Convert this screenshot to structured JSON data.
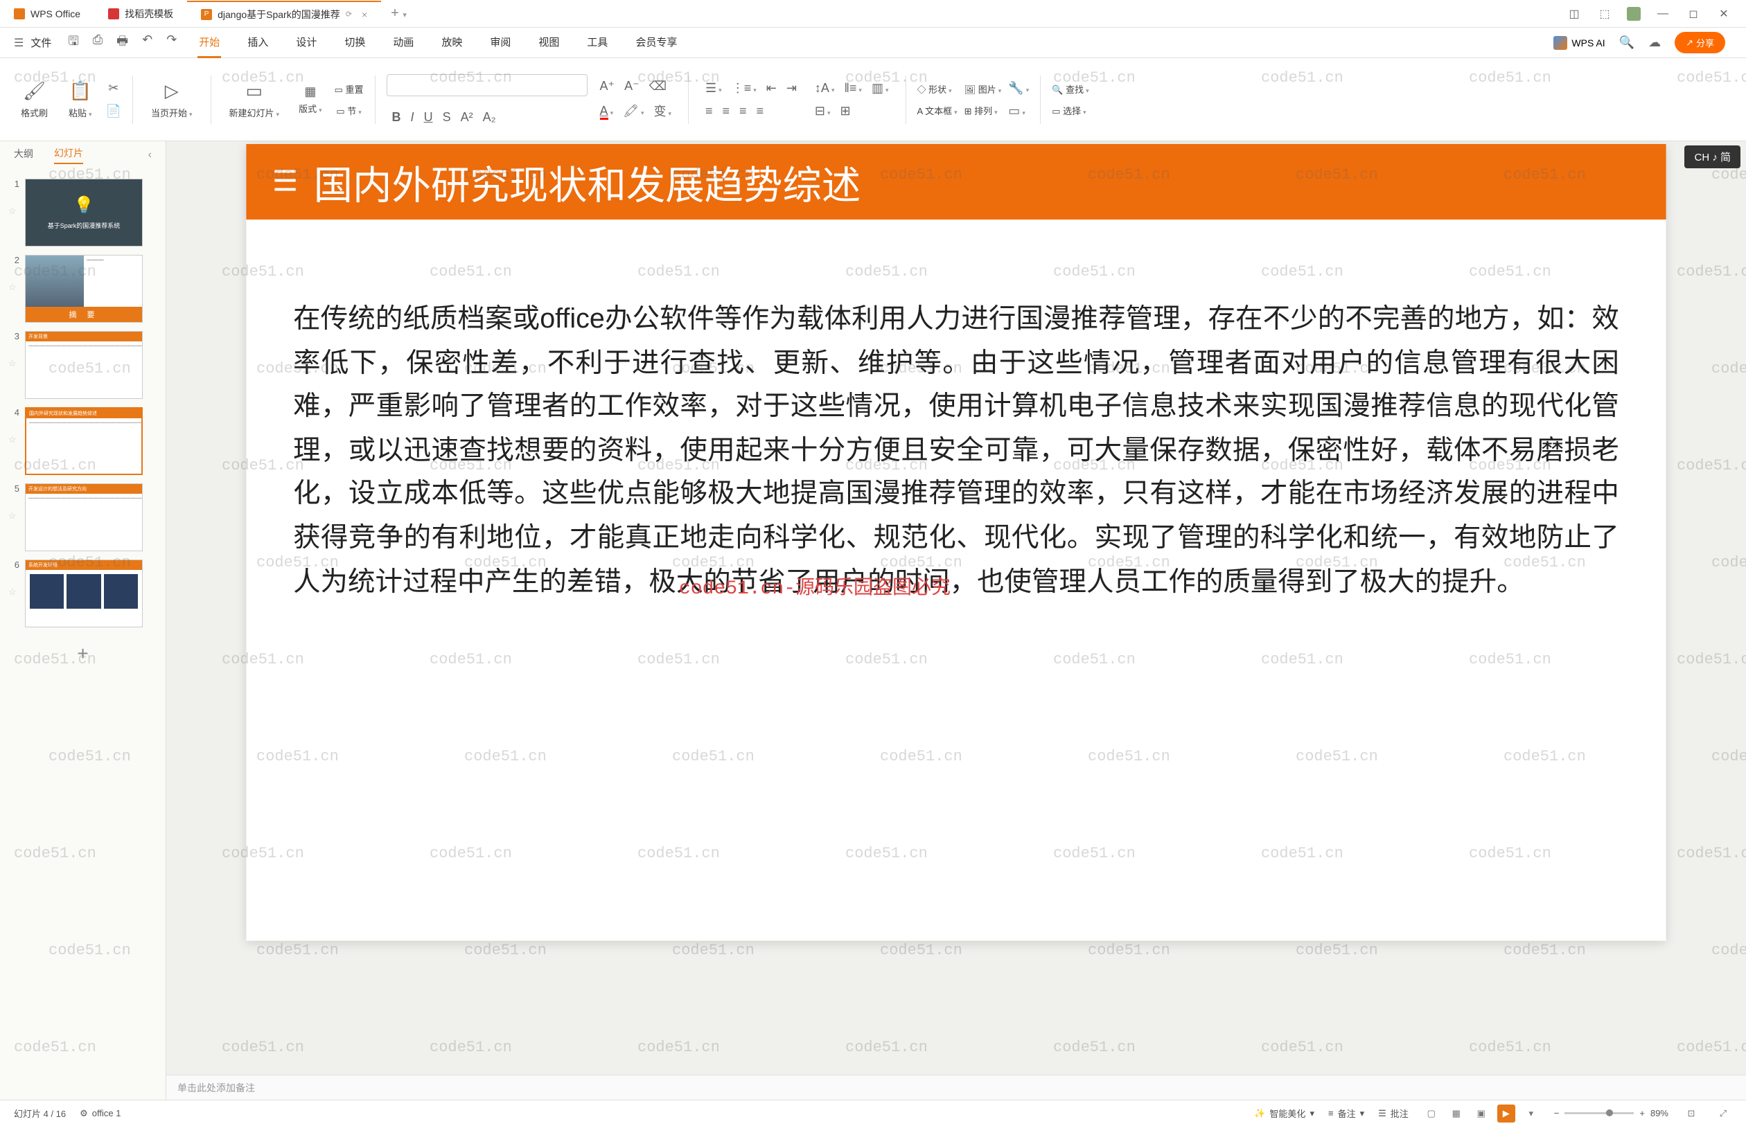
{
  "titlebar": {
    "tabs": [
      {
        "label": "WPS Office"
      },
      {
        "label": "找稻壳模板"
      },
      {
        "label": "django基于Spark的国漫推荐"
      }
    ],
    "add": "+"
  },
  "menubar": {
    "file": "文件",
    "tabs": [
      "开始",
      "插入",
      "设计",
      "切换",
      "动画",
      "放映",
      "审阅",
      "视图",
      "工具",
      "会员专享"
    ],
    "ai": "WPS AI",
    "share": "分享"
  },
  "ribbon": {
    "formatbrush": "格式刷",
    "paste": "粘贴",
    "currentstart": "当页开始",
    "newslide": "新建幻灯片",
    "layout": "版式",
    "section": "节",
    "reset": "重置",
    "shape": "形状",
    "image": "图片",
    "textbox": "文本框",
    "arrange": "排列",
    "find": "查找",
    "select": "选择"
  },
  "leftpanel": {
    "outline": "大纲",
    "slides": "幻灯片"
  },
  "thumbs": {
    "t1": "基于Spark的国漫推荐系统",
    "t2": "摘    要",
    "t3": "开发背景",
    "t4": "国内外研究现状和发展趋势综述",
    "t5": "开发设计的想法及研究方向",
    "t6": "系统开发环境"
  },
  "slide": {
    "title": "国内外研究现状和发展趋势综述",
    "body": "在传统的纸质档案或office办公软件等作为载体利用人力进行国漫推荐管理，存在不少的不完善的地方，如：效率低下，保密性差，不利于进行查找、更新、维护等。由于这些情况，管理者面对用户的信息管理有很大困难，严重影响了管理者的工作效率，对于这些情况，使用计算机电子信息技术来实现国漫推荐信息的现代化管理，或以迅速查找想要的资料，使用起来十分方便且安全可靠，可大量保存数据，保密性好，载体不易磨损老化，设立成本低等。这些优点能够极大地提高国漫推荐管理的效率，只有这样，才能在市场经济发展的进程中获得竞争的有利地位，才能真正地走向科学化、规范化、现代化。实现了管理的科学化和统一，有效地防止了人为统计过程中产生的差错，极大的节省了用户的时间，也使管理人员工作的质量得到了极大的提升。"
  },
  "badge": {
    "text": "CH ♪ 简"
  },
  "notes": {
    "placeholder": "单击此处添加备注"
  },
  "status": {
    "slide": "幻灯片 4 / 16",
    "office": "office 1",
    "beautify": "智能美化",
    "notes": "备注",
    "approve": "批注",
    "zoom": "89%"
  },
  "watermark": {
    "text": "code51.cn",
    "red": "code51.cn-源码乐园盗图必究"
  }
}
